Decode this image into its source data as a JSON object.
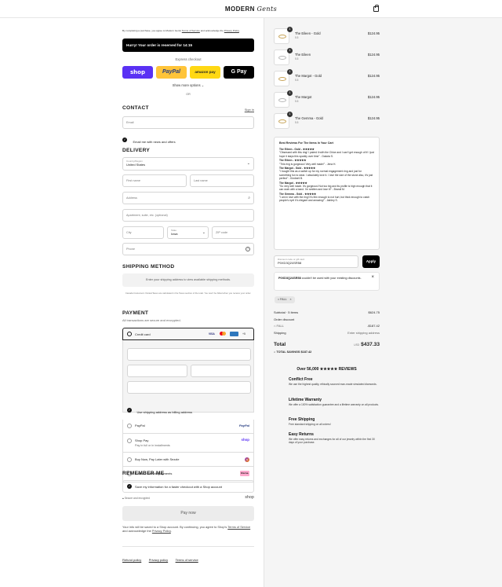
{
  "header": {
    "brand_main": "MODERN",
    "brand_script": "Gents",
    "cart_icon": "shopping-bag-icon"
  },
  "terms_notice": {
    "prefix": "By completing a purchase, you agree to Modern Gents ",
    "terms_link": "Terms of Service",
    "middle": " and acknowledge the ",
    "privacy_link": "Privacy Policy",
    "suffix": "."
  },
  "reservation": {
    "text": "Hurry! Your order is reserved for 14:15"
  },
  "express": {
    "label": "Express checkout",
    "shop_label": "shop",
    "paypal_label": "PayPal",
    "amazon_label": "amazon pay",
    "gpay_label": "G Pay",
    "more_label": "Show more options",
    "or_label": "OR",
    "colors": {
      "shop": "#5a31f4",
      "paypal": "#ffc439",
      "amazon": "#ffd814",
      "gpay": "#000000"
    }
  },
  "contact": {
    "title": "CONTACT",
    "signin_label": "Sign in",
    "email_placeholder": "Email",
    "news_label": "Email me with news and offers"
  },
  "delivery": {
    "title": "DELIVERY",
    "country_label": "Country/Region",
    "country_value": "United States",
    "first_name_placeholder": "First name",
    "last_name_placeholder": "Last name",
    "address_placeholder": "Address",
    "apartment_placeholder": "Apartment, suite, etc. (optional)",
    "city_placeholder": "City",
    "state_label": "State",
    "state_value": "Iowa",
    "zip_placeholder": "ZIP code",
    "phone_placeholder": "Phone"
  },
  "shipping": {
    "title": "SHIPPING METHOD",
    "placeholder": "Enter your shipping address to view available shipping methods.",
    "note": "Canada Customers: Duties/Taxes are calculated in the Taxes section of the total. You won't be billed when you receive your order."
  },
  "payment": {
    "title": "PAYMENT",
    "subtitle": "All transactions are secure and encrypted.",
    "credit_card_label": "Credit card",
    "more_cards": "+5",
    "billing_label": "Use shipping address as billing address",
    "options": [
      {
        "label": "PayPal",
        "sub": "",
        "logo": "PayPal"
      },
      {
        "label": "Shop Pay",
        "sub": "Pay in full or in installments",
        "logo": "shop"
      },
      {
        "label": "Buy Now, Pay Later with Sezzle",
        "sub": "",
        "logo": "S"
      },
      {
        "label": "Klarna - Flexible payments",
        "sub": "",
        "logo": "Klarna."
      }
    ]
  },
  "remember": {
    "title": "REMEMBER ME",
    "save_label": "Save my information for a faster checkout with a Shop account",
    "secure_label": "Secure and encrypted",
    "shop_logo": "shop"
  },
  "pay_now_label": "Pay now",
  "footer_note": {
    "prefix": "Your info will be saved to a Shop account. By continuing, you agree to Shop's ",
    "terms_link": "Terms of Service",
    "middle": " and acknowledge the ",
    "privacy_link": "Privacy Policy",
    "suffix": "."
  },
  "footer_links": [
    "Refund policy",
    "Privacy policy",
    "Terms of service"
  ],
  "cart": {
    "items": [
      {
        "name": "The Eileen - Gold",
        "size": "5.5",
        "price": "$124.95",
        "qty": "1",
        "gold": true
      },
      {
        "name": "The Eileen",
        "size": "5.5",
        "price": "$124.95",
        "qty": "1",
        "gold": false
      },
      {
        "name": "The Margot - Gold",
        "size": "5.5",
        "price": "$124.95",
        "qty": "1",
        "gold": true
      },
      {
        "name": "The Margot",
        "size": "5.5",
        "price": "$124.95",
        "qty": "1",
        "gold": false
      },
      {
        "name": "The Gemma - Gold",
        "size": "5.5",
        "price": "$124.95",
        "qty": "1",
        "gold": true
      }
    ]
  },
  "reviews": {
    "title": "Best Reviews For The Items In Your Cart",
    "entries": [
      {
        "product": "The Eileen - Gold - ★★★★★",
        "text": "\"Obsessed with this ring! I paired it with the Chloe and I can't get enough of it! I just hope it stays this sparkly over time\" - Dakota S."
      },
      {
        "product": "The Eileen - ★★★★★",
        "text": "\"This ring is gorgeous! Very well made!\" - Jena H."
      },
      {
        "product": "The Margot - Gold - ★★★★★",
        "text": "\"I bought this as a switch up for my normal engagement ring and just for something fun to wear. I absolutely love it. I love the size of the stone also, it's just perfect\" - Kimberli B."
      },
      {
        "product": "The Margot - ★★★★★",
        "text": "\"So very well made. It's gorgeous! Not too big and its profile is high enough that it can work with a band. I'm smitten and love it!\" - Brandi M."
      },
      {
        "product": "The Gemma - Gold - ★★★★★",
        "text": "\"I am in love with the ring! It's thin enough to not hurt, but thick enough to catch people's eye! It's elegant and amazing!\" - Ashley S."
      }
    ]
  },
  "discount": {
    "label": "Discount code or gift card",
    "value": "P0XD3Q24SR58",
    "apply_label": "Apply",
    "error_code": "P0XD3Q24SR58",
    "error_text": " couldn't be used with your existing discounts.",
    "tag_label": "FALL"
  },
  "summary": {
    "subtotal_label": "Subtotal · 5 items",
    "subtotal_value": "$624.75",
    "order_discount_label": "Order discount",
    "discount_tag": "FALL",
    "discount_value": "-$187.42",
    "shipping_label": "Shipping",
    "shipping_value": "Enter shipping address",
    "total_label": "Total",
    "currency": "USD",
    "total_value": "$437.33",
    "savings_label": "TOTAL SAVINGS",
    "savings_value": "$187.42"
  },
  "trust": {
    "title": "Over 56,000 ★★★★★ REVIEWS",
    "features": [
      {
        "title": "Conflict Free",
        "desc": "We use the highest quality, ethically sourced man-made simulated diamonds."
      },
      {
        "title": "Lifetime Warranty",
        "desc": "We offer a 100% satisfaction guarantee and a lifetime warranty on all products."
      },
      {
        "title": "Free Shipping",
        "desc": "Free standard shipping on all orders!"
      },
      {
        "title": "Easy Returns",
        "desc": "We offer easy returns and exchanges for all of our jewelry within the first 30 days of your purchase."
      }
    ]
  }
}
